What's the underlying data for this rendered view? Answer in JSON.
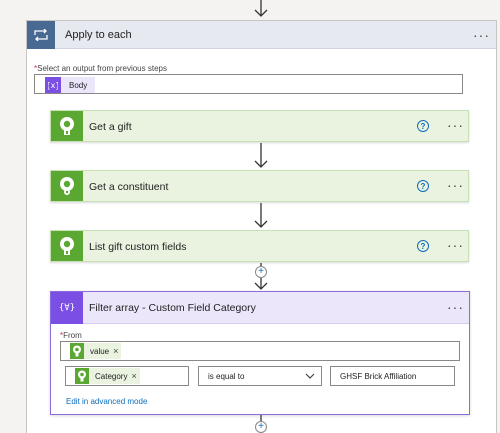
{
  "loop": {
    "title": "Apply to each",
    "select_label": "Select an output from previous steps",
    "select_token": "Body"
  },
  "cards": [
    {
      "title": "Get a gift"
    },
    {
      "title": "Get a constituent"
    },
    {
      "title": "List gift custom fields"
    }
  ],
  "filter": {
    "title": "Filter array - Custom Field Category",
    "icon_text": "{∀}",
    "from_label": "From",
    "from_token": "value",
    "left_token": "Category",
    "operator": "is equal to",
    "right_value": "GHSF Brick Affiliation",
    "advanced_link": "Edit in advanced mode"
  },
  "common": {
    "more_dots": "···",
    "help_glyph": "?",
    "required_mark": "*",
    "remove_glyph": "×",
    "plus_glyph": "+"
  },
  "colors": {
    "loop_header": "#486991",
    "action_green": "#5aa831",
    "filter_purple": "#7b4fe4",
    "link_blue": "#0f6cbd"
  }
}
